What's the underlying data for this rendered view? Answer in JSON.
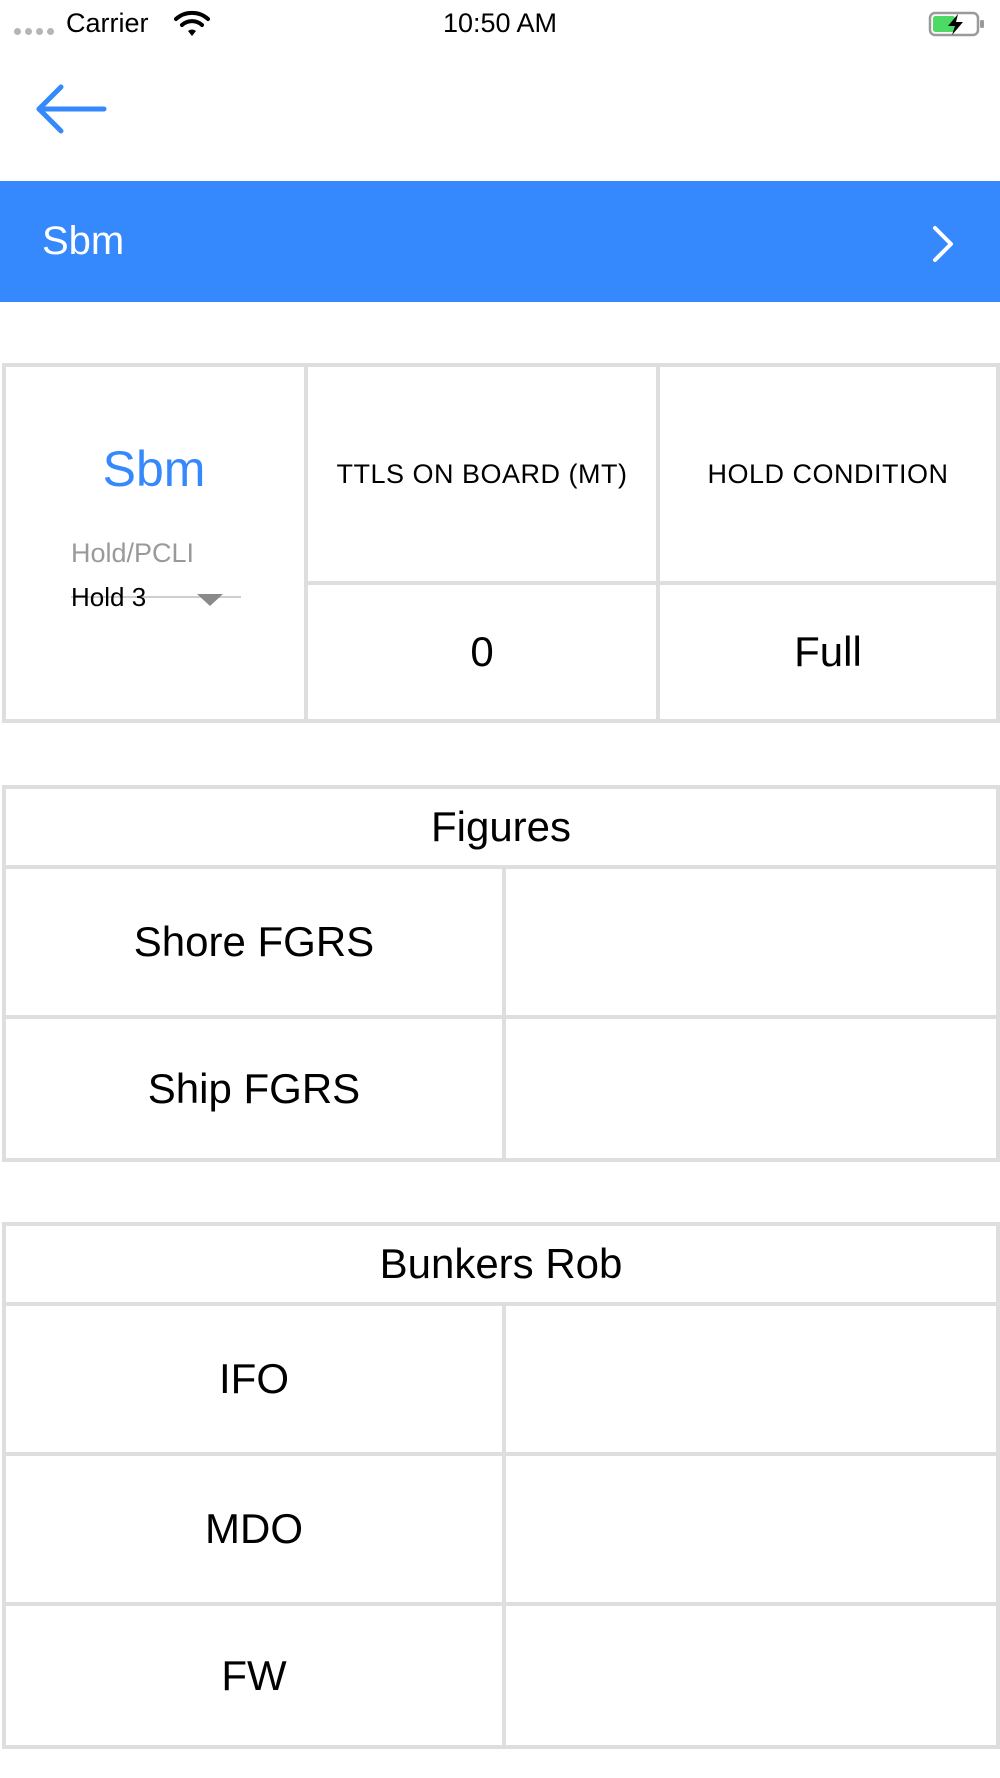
{
  "status_bar": {
    "carrier": "Carrier",
    "time": "10:50 AM",
    "icons": [
      "signal-dots-icon",
      "wifi-icon",
      "battery-charging-icon"
    ],
    "battery_color": "#4cd964"
  },
  "nav": {
    "back_icon": "arrow-left-icon",
    "accent_color": "#3589fd"
  },
  "header": {
    "title": "Sbm",
    "chevron_icon": "chevron-right-icon",
    "background": "#3589fd"
  },
  "hold": {
    "name": "Sbm",
    "dropdown_label": "Hold/PCLI",
    "dropdown_value": "Hold 3",
    "columns": [
      "TTLS ON BOARD (MT)",
      "HOLD CONDITION"
    ],
    "values": [
      "0",
      "Full"
    ]
  },
  "figures": {
    "title": "Figures",
    "rows": [
      {
        "label": "Shore FGRS",
        "value": ""
      },
      {
        "label": "Ship FGRS",
        "value": ""
      }
    ]
  },
  "bunkers": {
    "title": "Bunkers Rob",
    "rows": [
      {
        "label": "IFO",
        "value": ""
      },
      {
        "label": "MDO",
        "value": ""
      },
      {
        "label": "FW",
        "value": ""
      }
    ]
  }
}
